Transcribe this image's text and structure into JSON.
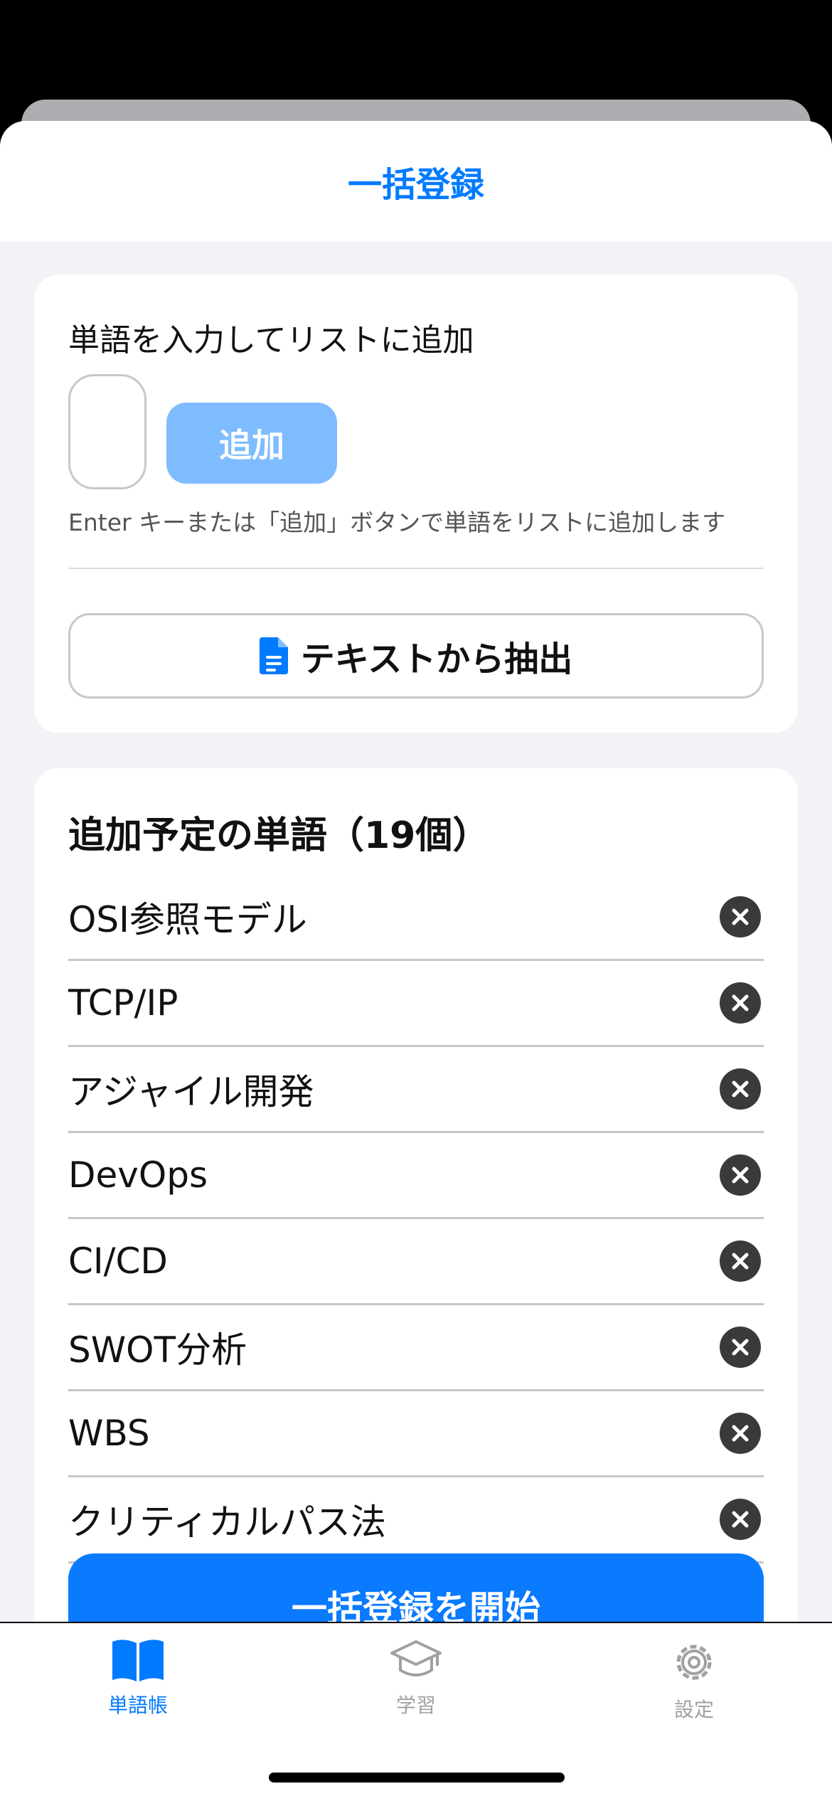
{
  "sheet": {
    "title": "一括登録"
  },
  "input_section": {
    "label": "単語を入力してリストに追加",
    "input_value": "",
    "add_button_label": "追加",
    "hint": "Enter キーまたは「追加」ボタンで単語をリストに追加します",
    "extract_button_label": "テキストから抽出",
    "extract_icon": "document-icon"
  },
  "word_list": {
    "heading": "追加予定の単語（19個）",
    "items": [
      {
        "label": "OSI参照モデル"
      },
      {
        "label": "TCP/IP"
      },
      {
        "label": "アジャイル開発"
      },
      {
        "label": "DevOps"
      },
      {
        "label": "CI/CD"
      },
      {
        "label": "SWOT分析"
      },
      {
        "label": "WBS"
      },
      {
        "label": "クリティカルパス法"
      }
    ],
    "remove_icon": "close-circle-icon"
  },
  "bulk_button_label": "一括登録を開始",
  "tabbar": {
    "tabs": [
      {
        "label": "単語帳",
        "icon": "book-icon",
        "active": true
      },
      {
        "label": "学習",
        "icon": "graduation-cap-icon",
        "active": false
      },
      {
        "label": "設定",
        "icon": "gear-icon",
        "active": false
      }
    ]
  },
  "colors": {
    "accent": "#007aff",
    "disabled_button": "#7fbcff",
    "inactive_tab": "#a0a0a5"
  }
}
